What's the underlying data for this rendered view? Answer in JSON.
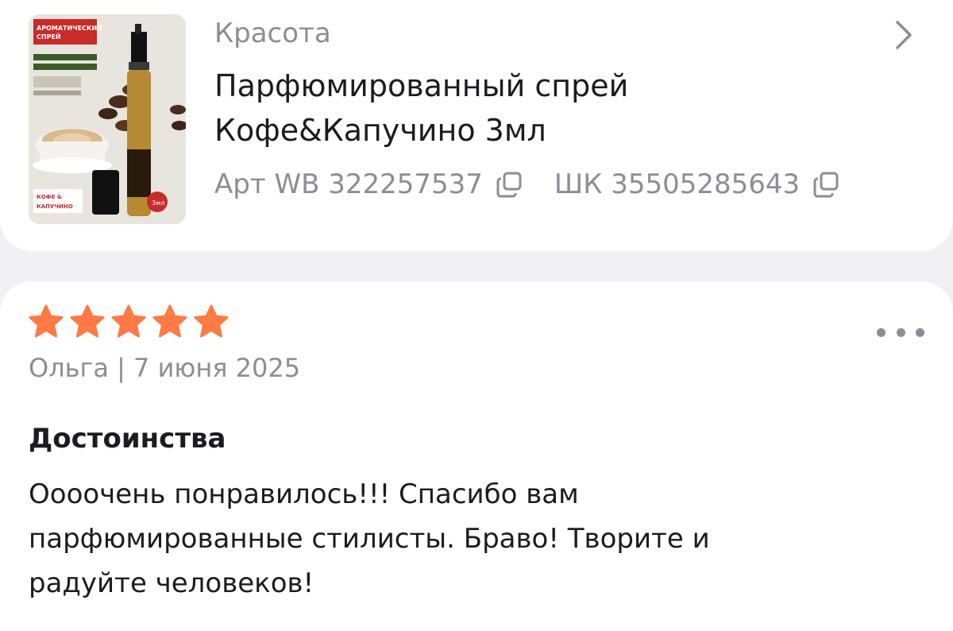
{
  "product": {
    "category": "Красота",
    "title_line1": "Парфюмированный спрей",
    "title_line2": "Кофе&Капучино 3мл",
    "art_label": "Арт WB 322257537",
    "barcode_label": "ШК 35505285643",
    "thumbnail": {
      "headline_line1": "АРОМАТИЧЕСКИЙ",
      "headline_line2": "СПРЕЙ",
      "flavor_line1": "КОФЕ &",
      "flavor_line2": "КАПУЧИНО",
      "volume_badge": "3мл"
    },
    "icons": {
      "chevron": "chevron-right-icon",
      "copy": "copy-icon"
    }
  },
  "review": {
    "rating": 5,
    "rating_max": 5,
    "author_date": "Ольга | 7 июня 2025",
    "section_title": "Достоинства",
    "text_line1": "Оооочень понравилось!!! Спасибо вам",
    "text_line2": "парфюмированные стилисты. Браво! Творите и",
    "text_line3": "радуйте человеков!",
    "icons": {
      "more": "more-dots-icon",
      "star": "star-icon"
    }
  },
  "colors": {
    "star": "#ff7a45",
    "muted_text": "#8e8c96",
    "primary_text": "#1c1b21",
    "page_background": "#f1f0f5",
    "card_background": "#ffffff"
  }
}
